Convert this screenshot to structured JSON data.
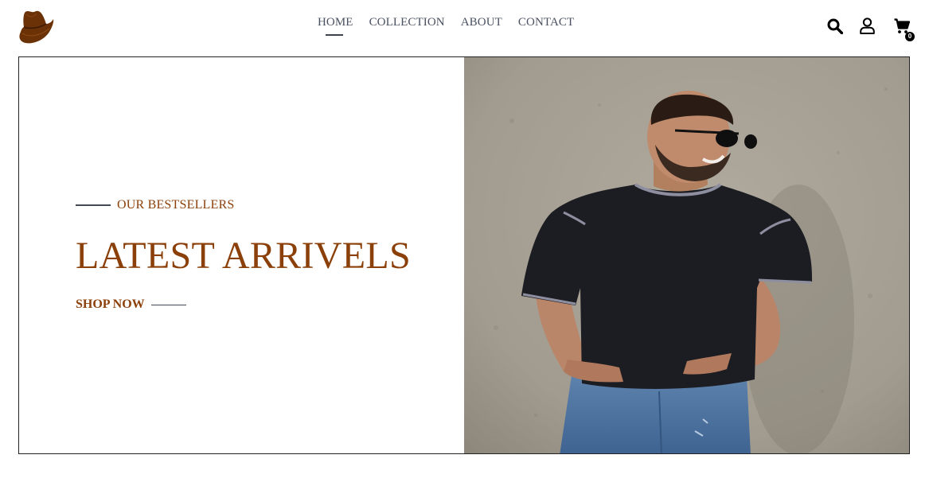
{
  "header": {
    "logo_icon": "cowboy-hat-icon",
    "nav": [
      {
        "label": "HOME",
        "active": true
      },
      {
        "label": "COLLECTION",
        "active": false
      },
      {
        "label": "ABOUT",
        "active": false
      },
      {
        "label": "CONTACT",
        "active": false
      }
    ],
    "icons": [
      "search-icon",
      "user-icon",
      "cart-icon"
    ],
    "cart_count": "0"
  },
  "hero": {
    "eyebrow": "OUR BESTSELLERS",
    "title": "LATEST ARRIVELS",
    "cta_label": "SHOP NOW",
    "image": "photo-man-black-tshirt"
  },
  "colors": {
    "brand_brown": "#8b3f09",
    "nav_text": "#4a5160",
    "line": "#414a56"
  }
}
